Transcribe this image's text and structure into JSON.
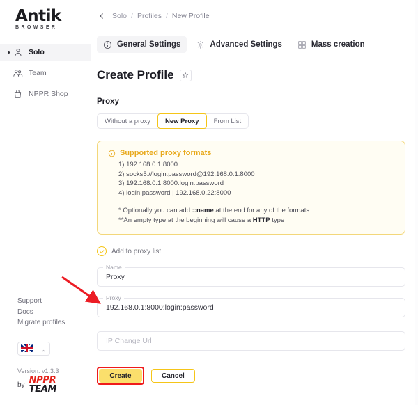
{
  "brand": {
    "logo_primary": "Antik",
    "logo_secondary": "BROWSER",
    "footer_by": "by",
    "footer_brand_line1": "NPPR",
    "footer_brand_line2": "TEAM",
    "accent_yellow": "#f5c518",
    "accent_yellow_soft": "#fbdf6c",
    "highlight_red": "#ef1b1b",
    "brand_red": "#e32119"
  },
  "sidebar": {
    "items": [
      {
        "label": "Solo",
        "icon": "user-icon",
        "active": true
      },
      {
        "label": "Team",
        "icon": "users-icon",
        "active": false
      },
      {
        "label": "NPPR Shop",
        "icon": "shopping-bag-icon",
        "active": false
      }
    ],
    "links": [
      {
        "label": "Support"
      },
      {
        "label": "Docs"
      },
      {
        "label": "Migrate profiles"
      }
    ],
    "language": {
      "flag": "uk-flag-icon",
      "chevron": "chevron-up-icon"
    },
    "version": "Version: v1.3.3"
  },
  "breadcrumb": {
    "back_icon": "chevron-left-icon",
    "items": [
      "Solo",
      "Profiles",
      "New Profile"
    ],
    "separator": "/"
  },
  "tabs": [
    {
      "label": "General Settings",
      "icon": "info-circle-icon",
      "active": true
    },
    {
      "label": "Advanced Settings",
      "icon": "gear-icon",
      "active": false
    },
    {
      "label": "Mass creation",
      "icon": "grid-icon",
      "active": false
    }
  ],
  "page": {
    "title": "Create Profile",
    "favorite_icon": "star-icon",
    "section_label": "Proxy"
  },
  "proxy_mode": {
    "options": [
      {
        "label": "Without a proxy",
        "selected": false
      },
      {
        "label": "New Proxy",
        "selected": true
      },
      {
        "label": "From List",
        "selected": false
      }
    ]
  },
  "info_box": {
    "icon": "info-circle-icon",
    "title": "Supported proxy formats",
    "formats": [
      "1) 192.168.0.1:8000",
      "2) socks5://login:password@192.168.0.1:8000",
      "3) 192.168.0.1:8000:login:password",
      "4) login:password | 192.168.0.22:8000"
    ],
    "notes": [
      {
        "prefix": "* Optionally you can add ",
        "bold": "::name",
        "suffix": " at the end for any of the formats."
      },
      {
        "prefix": "**An empty type at the beginning will cause a ",
        "bold": "HTTP",
        "suffix": " type"
      }
    ]
  },
  "form": {
    "add_to_list": {
      "label": "Add to proxy list",
      "checked": true,
      "icon": "check-circle-icon"
    },
    "fields": [
      {
        "legend": "Name",
        "value": "Proxy",
        "placeholder": ""
      },
      {
        "legend": "Proxy",
        "value": "192.168.0.1:8000:login:password",
        "placeholder": ""
      },
      {
        "legend": "",
        "value": "",
        "placeholder": "IP Change Url"
      }
    ]
  },
  "actions": {
    "create_label": "Create",
    "cancel_label": "Cancel"
  },
  "annotation": {
    "arrow": "red-arrow-pointing-to-proxy-field"
  }
}
